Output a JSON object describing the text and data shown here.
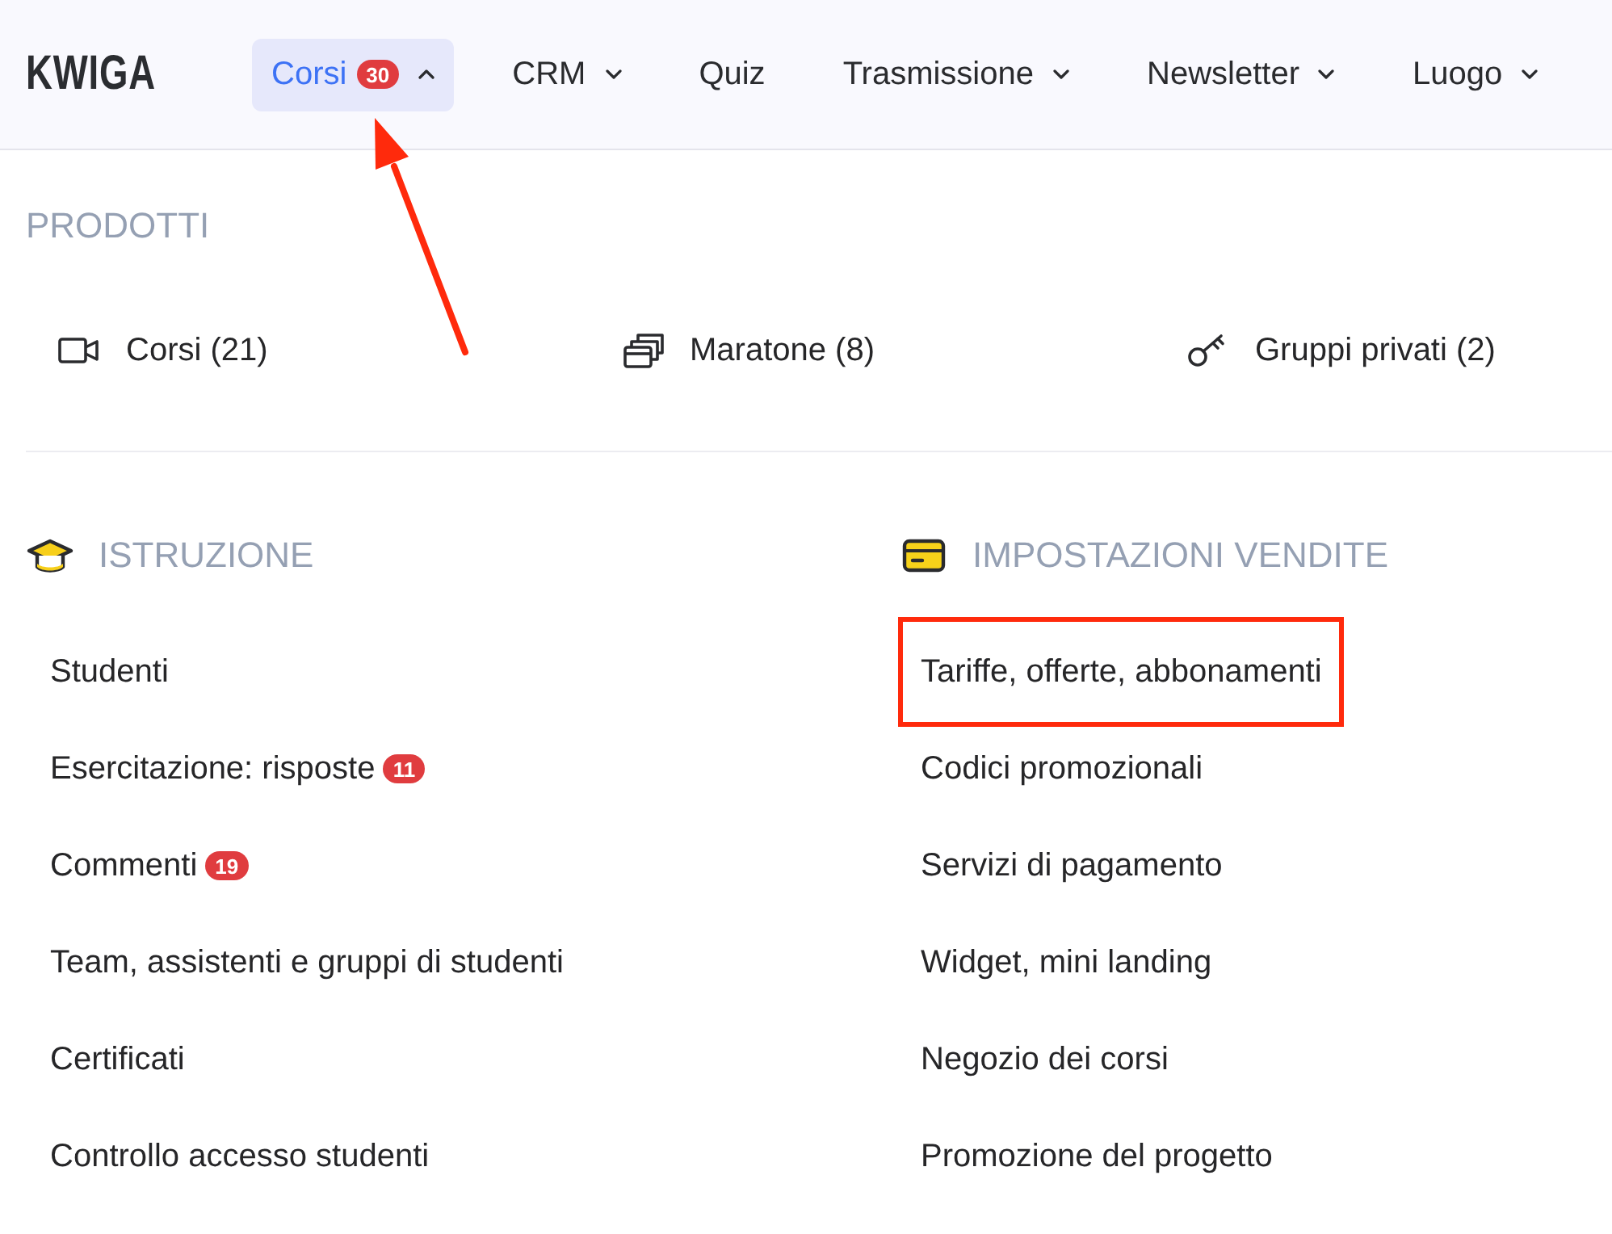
{
  "logo": "KWIGA",
  "nav": [
    {
      "label": "Corsi",
      "badge": "30",
      "kind": "dropdown",
      "selected": true,
      "expanded": true,
      "annotated": true
    },
    {
      "label": "CRM",
      "kind": "dropdown",
      "selected": false,
      "expanded": false,
      "annotated": false
    },
    {
      "label": "Quiz",
      "kind": "link",
      "selected": false,
      "annotated": false
    },
    {
      "label": "Trasmissione",
      "kind": "dropdown",
      "selected": false,
      "expanded": false,
      "annotated": false
    },
    {
      "label": "Newsletter",
      "kind": "dropdown",
      "selected": false,
      "expanded": false,
      "annotated": false
    },
    {
      "label": "Luogo",
      "kind": "dropdown",
      "selected": false,
      "expanded": false,
      "annotated": false
    }
  ],
  "products": {
    "title": "PRODOTTI",
    "items": [
      {
        "kind": "video",
        "label": "Corsi (21)"
      },
      {
        "kind": "stack",
        "label": "Maratone (8)"
      },
      {
        "kind": "key",
        "label": "Gruppi privati (2)"
      }
    ]
  },
  "sections": [
    {
      "kind": "education",
      "title": "ISTRUZIONE",
      "items": [
        {
          "label": "Studenti",
          "highlighted": false
        },
        {
          "label": "Esercitazione: risposte",
          "badge": "11",
          "highlighted": false
        },
        {
          "label": "Commenti",
          "badge": "19",
          "highlighted": false
        },
        {
          "label": "Team, assistenti e gruppi di studenti",
          "highlighted": false
        },
        {
          "label": "Certificati",
          "highlighted": false
        },
        {
          "label": "Controllo accesso studenti",
          "highlighted": false
        }
      ]
    },
    {
      "kind": "sales",
      "title": "IMPOSTAZIONI VENDITE",
      "items": [
        {
          "label": "Tariffe, offerte, abbonamenti",
          "highlighted": true
        },
        {
          "label": "Codici promozionali",
          "highlighted": false
        },
        {
          "label": "Servizi di pagamento",
          "highlighted": false
        },
        {
          "label": "Widget, mini landing",
          "highlighted": false
        },
        {
          "label": "Negozio dei corsi",
          "highlighted": false
        },
        {
          "label": "Promozione del progetto",
          "highlighted": false
        }
      ]
    }
  ]
}
